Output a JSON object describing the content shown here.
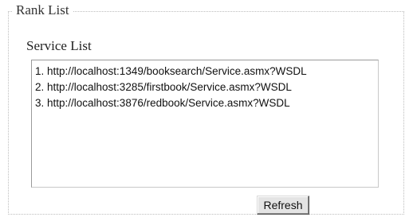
{
  "panel": {
    "title": "Rank List"
  },
  "service_list": {
    "label": "Service List",
    "items": [
      "1. http://localhost:1349/booksearch/Service.asmx?WSDL",
      "2. http://localhost:3285/firstbook/Service.asmx?WSDL",
      "3. http://localhost:3876/redbook/Service.asmx?WSDL"
    ]
  },
  "actions": {
    "refresh_label": "Refresh"
  }
}
